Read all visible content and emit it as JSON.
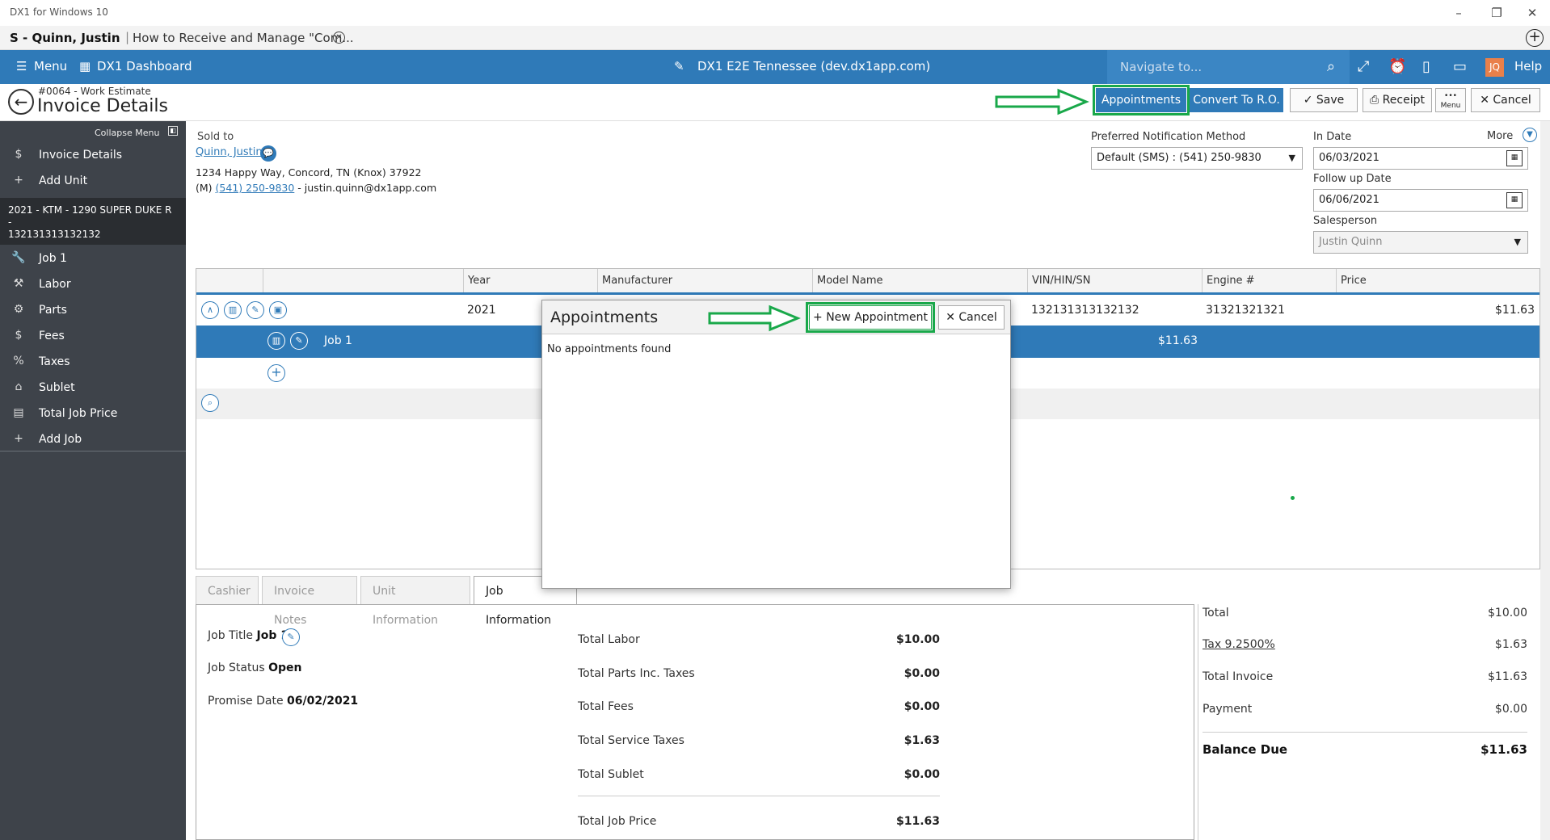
{
  "window": {
    "title": "DX1 for Windows 10"
  },
  "tabbar": {
    "user": "S - Quinn, Justin",
    "doc": "How to Receive and Manage \"Com..."
  },
  "header": {
    "menu": "Menu",
    "dashboard": "DX1 Dashboard",
    "environment": "DX1 E2E Tennessee (dev.dx1app.com)",
    "navigate_placeholder": "Navigate to...",
    "initials": "JQ",
    "help": "Help"
  },
  "page": {
    "subtitle": "#0064 - Work Estimate",
    "title": "Invoice Details",
    "buttons": {
      "appointments": "Appointments",
      "convert": "Convert To R.O.",
      "save": "Save",
      "receipt": "Receipt",
      "menu": "Menu",
      "cancel": "Cancel"
    }
  },
  "sidebar": {
    "collapse": "Collapse Menu",
    "items": [
      {
        "label": "Invoice Details"
      },
      {
        "label": "Add Unit"
      },
      {
        "label": "Job 1"
      },
      {
        "label": "Labor"
      },
      {
        "label": "Parts"
      },
      {
        "label": "Fees"
      },
      {
        "label": "Taxes"
      },
      {
        "label": "Sublet"
      },
      {
        "label": "Total Job Price"
      },
      {
        "label": "Add Job"
      }
    ],
    "unit_line1": "2021 - KTM - 1290 SUPER DUKE R -",
    "unit_line2": "132131313132132"
  },
  "customer": {
    "sold_to_label": "Sold to",
    "name": "Quinn, Justin",
    "address": "1234 Happy Way, Concord, TN (Knox) 37922",
    "phone_prefix": "(M)",
    "phone": "(541) 250-9830",
    "email": "- justin.quinn@dx1app.com"
  },
  "notification": {
    "label": "Preferred Notification Method",
    "value": "Default (SMS) : (541) 250-9830"
  },
  "dates": {
    "more": "More",
    "in_date_label": "In Date",
    "in_date": "06/03/2021",
    "follow_up_label": "Follow up Date",
    "follow_up": "06/06/2021",
    "salesperson_label": "Salesperson",
    "salesperson": "Justin Quinn"
  },
  "grid": {
    "headers": [
      "Year",
      "Manufacturer",
      "Model Name",
      "VIN/HIN/SN",
      "Engine #",
      "Price"
    ],
    "unit": {
      "year": "2021",
      "vin": "132131313132132",
      "engine": "31321321321",
      "price": "$11.63"
    },
    "job": {
      "name": "Job 1",
      "price": "$11.63"
    }
  },
  "modal": {
    "title": "Appointments",
    "new_button": "New Appointment",
    "cancel_button": "Cancel",
    "empty": "No appointments found"
  },
  "tabs": [
    "Cashier",
    "Invoice Notes",
    "Unit Information",
    "Job Information"
  ],
  "job_info": {
    "title_label": "Job Title",
    "title": "Job 1",
    "status_label": "Job Status",
    "status": "Open",
    "promise_label": "Promise Date",
    "promise": "06/02/2021",
    "rows": [
      {
        "label": "Total Labor",
        "value": "$10.00"
      },
      {
        "label": "Total Parts Inc. Taxes",
        "value": "$0.00"
      },
      {
        "label": "Total Fees",
        "value": "$0.00"
      },
      {
        "label": "Total Service Taxes",
        "value": "$1.63"
      },
      {
        "label": "Total Sublet",
        "value": "$0.00"
      }
    ],
    "total_label": "Total Job Price",
    "total_value": "$11.63"
  },
  "totals": {
    "total_label": "Total",
    "total": "$10.00",
    "tax_label": "Tax 9.2500%",
    "tax": "$1.63",
    "invoice_label": "Total Invoice",
    "invoice": "$11.63",
    "payment_label": "Payment",
    "payment": "$0.00",
    "balance_label": "Balance Due",
    "balance": "$11.63"
  },
  "colors": {
    "brand": "#2f7ab8",
    "highlight": "#19a84a",
    "sidebar": "#3e434a"
  }
}
